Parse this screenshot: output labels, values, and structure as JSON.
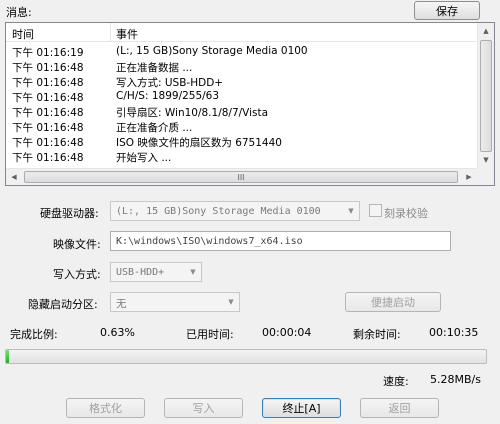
{
  "messages_label": "消息:",
  "save_button": "保存",
  "log": {
    "columns": {
      "time": "时间",
      "event": "事件"
    },
    "rows": [
      {
        "time": "下午 01:16:19",
        "event": "(L:, 15 GB)Sony    Storage Media    0100"
      },
      {
        "time": "下午 01:16:48",
        "event": "正在准备数据 ..."
      },
      {
        "time": "下午 01:16:48",
        "event": "写入方式: USB-HDD+"
      },
      {
        "time": "下午 01:16:48",
        "event": "C/H/S: 1899/255/63"
      },
      {
        "time": "下午 01:16:48",
        "event": "引导扇区: Win10/8.1/8/7/Vista"
      },
      {
        "time": "下午 01:16:48",
        "event": "正在准备介质 ..."
      },
      {
        "time": "下午 01:16:48",
        "event": "ISO 映像文件的扇区数为 6751440"
      },
      {
        "time": "下午 01:16:48",
        "event": "开始写入 ..."
      }
    ],
    "hscroll_grip": "III"
  },
  "form": {
    "disk_drive_label": "硬盘驱动器:",
    "disk_drive_value": "(L:, 15 GB)Sony    Storage Media    0100",
    "verify_label": "刻录校验",
    "image_file_label": "映像文件:",
    "image_file_value": "K:\\windows\\ISO\\windows7_x64.iso",
    "write_method_label": "写入方式:",
    "write_method_value": "USB-HDD+",
    "hidden_partition_label": "隐藏启动分区:",
    "hidden_partition_value": "无",
    "portable_boot_button": "便捷启动"
  },
  "status": {
    "complete_label": "完成比例:",
    "complete_value": "0.63%",
    "progress_fraction": 0.0063,
    "elapsed_label": "已用时间:",
    "elapsed_value": "00:00:04",
    "remaining_label": "剩余时间:",
    "remaining_value": "00:10:35",
    "speed_label": "速度:",
    "speed_value": "5.28MB/s"
  },
  "buttons": {
    "format": "格式化",
    "write": "写入",
    "abort": "终止[A]",
    "back": "返回"
  },
  "colors": {
    "progress_fill": "#2cbc2c"
  }
}
